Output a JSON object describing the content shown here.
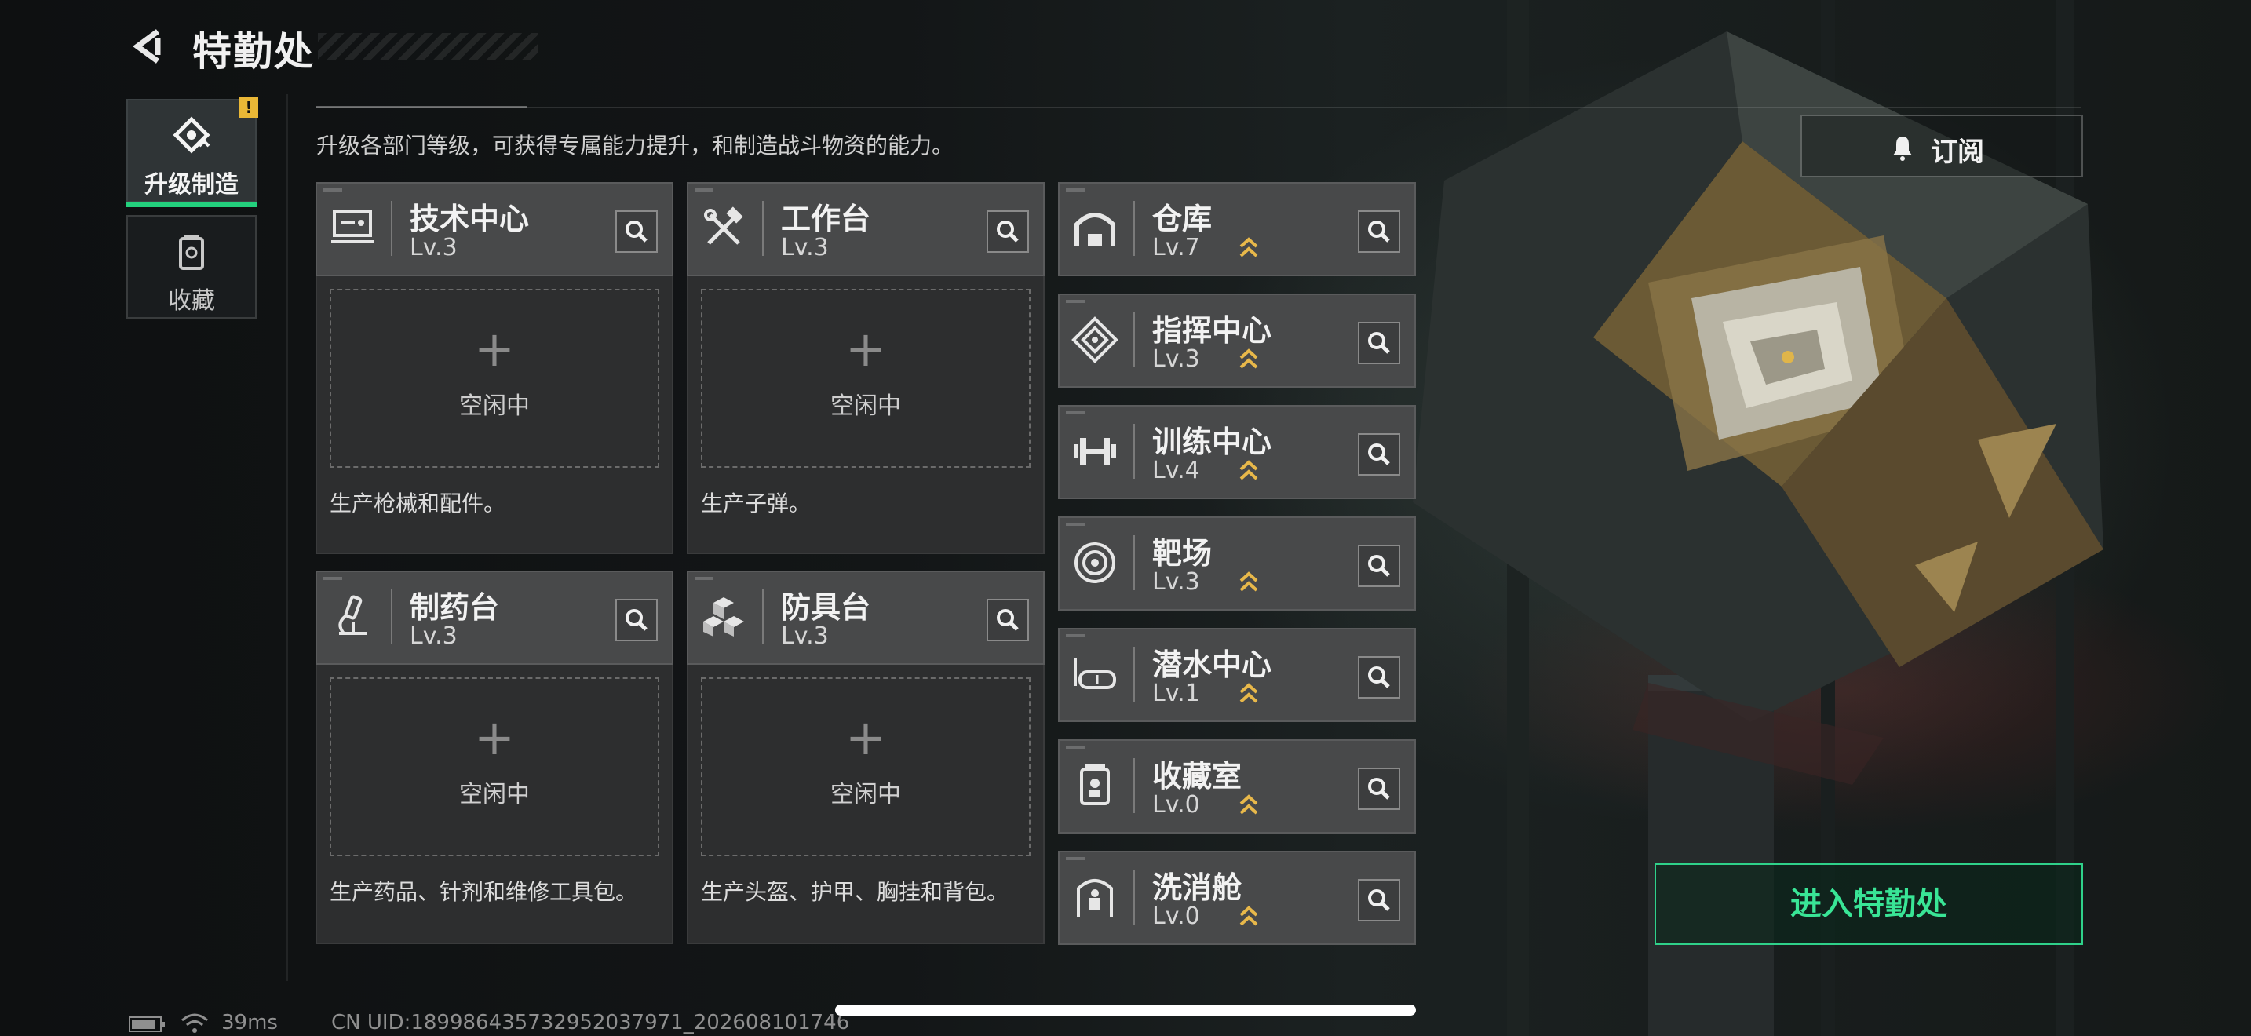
{
  "header": {
    "title": "特勤处",
    "subtitle": "升级各部门等级，可获得专属能力提升，和制造战斗物资的能力。"
  },
  "nav": {
    "items": [
      {
        "label": "升级制造",
        "badge": "!"
      },
      {
        "label": "收藏"
      }
    ]
  },
  "production": [
    {
      "name": "技术中心",
      "level": "Lv.3",
      "slot_status": "空闲中",
      "slot_plus": "+",
      "description": "生产枪械和配件。"
    },
    {
      "name": "工作台",
      "level": "Lv.3",
      "slot_status": "空闲中",
      "slot_plus": "+",
      "description": "生产子弹。"
    },
    {
      "name": "制药台",
      "level": "Lv.3",
      "slot_status": "空闲中",
      "slot_plus": "+",
      "description": "生产药品、针剂和维修工具包。"
    },
    {
      "name": "防具台",
      "level": "Lv.3",
      "slot_status": "空闲中",
      "slot_plus": "+",
      "description": "生产头盔、护甲、胸挂和背包。"
    }
  ],
  "facilities": [
    {
      "name": "仓库",
      "level": "Lv.7"
    },
    {
      "name": "指挥中心",
      "level": "Lv.3"
    },
    {
      "name": "训练中心",
      "level": "Lv.4"
    },
    {
      "name": "靶场",
      "level": "Lv.3"
    },
    {
      "name": "潜水中心",
      "level": "Lv.1"
    },
    {
      "name": "收藏室",
      "level": "Lv.0"
    },
    {
      "name": "洗消舱",
      "level": "Lv.0"
    }
  ],
  "buttons": {
    "subscribe": "订阅",
    "enter": "进入特勤处"
  },
  "status_bar": {
    "ping": "39ms",
    "uid": "CN UID:18998643573295203797‍1_202608101746"
  },
  "colors": {
    "accent_green": "#23d07d",
    "badge_yellow": "#e9b736",
    "level_chevron": "#e8b84a"
  }
}
